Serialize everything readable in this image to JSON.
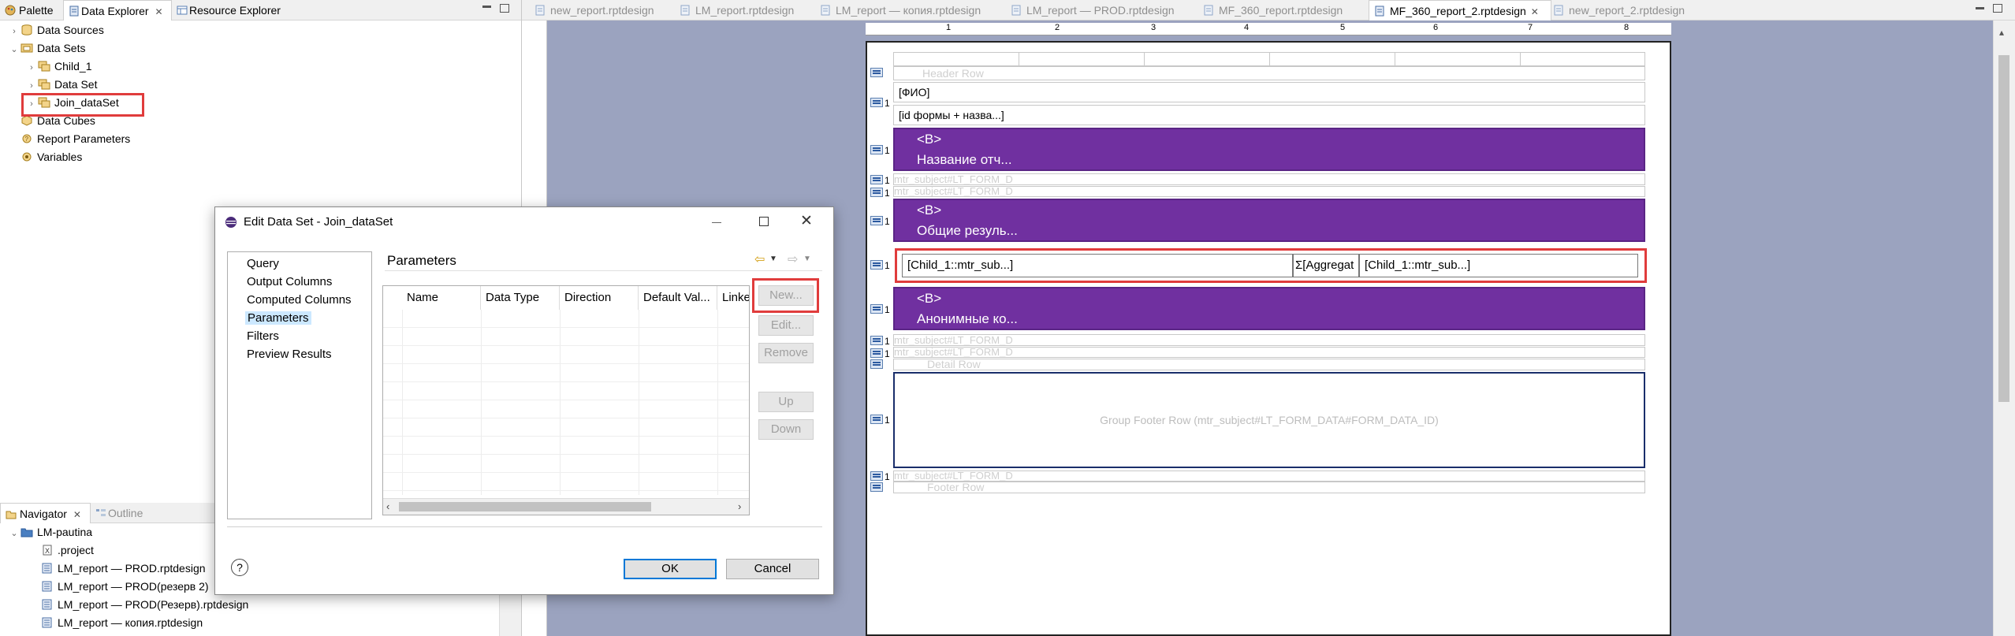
{
  "left_panel": {
    "tabs": [
      "Palette",
      "Data Explorer",
      "Resource Explorer"
    ],
    "tree": [
      {
        "label": "Data Sources"
      },
      {
        "label": "Data Sets"
      },
      {
        "label": "Child_1"
      },
      {
        "label": "Data Set"
      },
      {
        "label": "Join_dataSet"
      },
      {
        "label": "Data Cubes"
      },
      {
        "label": "Report Parameters"
      },
      {
        "label": "Variables"
      }
    ]
  },
  "navigator": {
    "tabs": [
      "Navigator",
      "Outline"
    ],
    "items": [
      "LM-pautina",
      ".project",
      "LM_report — PROD.rptdesign",
      "LM_report — PROD(резерв 2)",
      "LM_report — PROD(Резерв).rptdesign",
      "LM_report — копия.rptdesign"
    ]
  },
  "editor_tabs": [
    "new_report.rptdesign",
    "LM_report.rptdesign",
    "LM_report — копия.rptdesign",
    "LM_report — PROD.rptdesign",
    "MF_360_report.rptdesign",
    "MF_360_report_2.rptdesign",
    "new_report_2.rptdesign"
  ],
  "ruler": [
    "1",
    "2",
    "3",
    "4",
    "5",
    "6",
    "7",
    "8"
  ],
  "report": {
    "header_row": "Header Row",
    "fio": "[ФИО]",
    "id_form": "[id формы + назва...]",
    "purple1": [
      "<B>",
      "Название отч..."
    ],
    "mtr1": "mtr_subject#LT_FORM_D",
    "mtr2": "mtr_subject#LT_FORM_D",
    "purple2": [
      "<B>",
      "Общие резуль..."
    ],
    "data_row": [
      "[Child_1::mtr_sub...]",
      "Σ[Aggregat",
      "[Child_1::mtr_sub...]"
    ],
    "purple3": [
      "<B>",
      "Анонимные ко..."
    ],
    "mtr3": "mtr_subject#LT_FORM_D",
    "mtr4": "mtr_subject#LT_FORM_D",
    "detail_row": "Detail Row",
    "group_footer": "Group Footer Row (mtr_subject#LT_FORM_DATA#FORM_DATA_ID)",
    "mtr5": "mtr_subject#LT_FORM_D",
    "footer_row": "Footer Row"
  },
  "dialog": {
    "title": "Edit Data Set - Join_dataSet",
    "nav": [
      "Query",
      "Output Columns",
      "Computed Columns",
      "Parameters",
      "Filters",
      "Preview Results"
    ],
    "selected_nav": "Parameters",
    "section_title": "Parameters",
    "columns": [
      "Name",
      "Data Type",
      "Direction",
      "Default Val...",
      "Linke"
    ],
    "buttons": [
      "New...",
      "Edit...",
      "Remove",
      "Up",
      "Down"
    ],
    "ok": "OK",
    "cancel": "Cancel",
    "help": "?"
  },
  "colors": {
    "purple": "#7030a0",
    "highlight": "#e03c3c",
    "canvas": "#9ba3bf"
  }
}
